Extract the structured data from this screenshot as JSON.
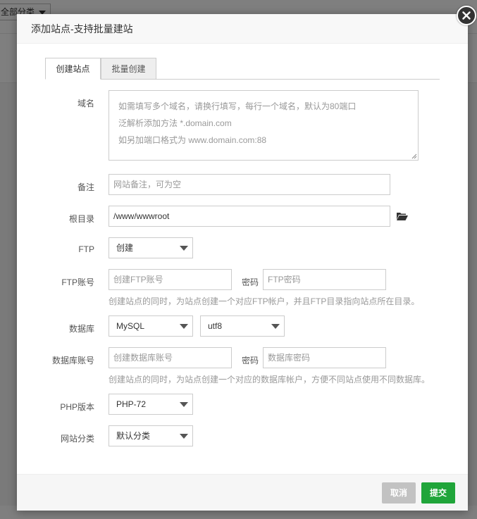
{
  "background": {
    "category_select": "全部分类"
  },
  "dialog": {
    "title": "添加站点-支持批量建站",
    "tabs": [
      {
        "label": "创建站点",
        "active": true
      },
      {
        "label": "批量创建",
        "active": false
      }
    ],
    "domain": {
      "label": "域名",
      "placeholder_lines": [
        "如需填写多个域名，请换行填写，每行一个域名，默认为80端口",
        "泛解析添加方法 *.domain.com",
        "如另加端口格式为 www.domain.com:88"
      ]
    },
    "remark": {
      "label": "备注",
      "placeholder": "网站备注，可为空"
    },
    "root": {
      "label": "根目录",
      "value": "/www/wwwroot",
      "icon": "folder-open-icon"
    },
    "ftp": {
      "label": "FTP",
      "selected": "创建"
    },
    "ftp_account": {
      "label": "FTP账号",
      "user_placeholder": "创建FTP账号",
      "password_label": "密码",
      "password_placeholder": "FTP密码",
      "help": "创建站点的同时，为站点创建一个对应FTP帐户，并且FTP目录指向站点所在目录。"
    },
    "database": {
      "label": "数据库",
      "selected": "MySQL",
      "charset": "utf8"
    },
    "database_account": {
      "label": "数据库账号",
      "user_placeholder": "创建数据库账号",
      "password_label": "密码",
      "password_placeholder": "数据库密码",
      "help": "创建站点的同时，为站点创建一个对应的数据库帐户，方便不同站点使用不同数据库。"
    },
    "php": {
      "label": "PHP版本",
      "selected": "PHP-72"
    },
    "category": {
      "label": "网站分类",
      "selected": "默认分类"
    },
    "buttons": {
      "cancel": "取消",
      "submit": "提交"
    },
    "colors": {
      "submit": "#20a53a",
      "cancel": "#c2c2c2"
    }
  }
}
